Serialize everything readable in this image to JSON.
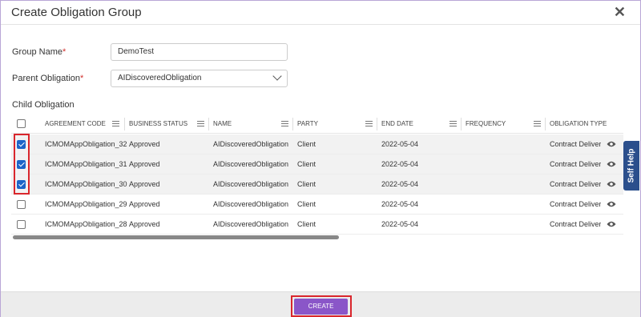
{
  "dialog": {
    "title": "Create Obligation Group",
    "close_icon": "close-icon"
  },
  "form": {
    "group_name_label": "Group Name",
    "group_name_value": "DemoTest",
    "parent_obligation_label": "Parent Obligation",
    "parent_obligation_value": "AIDiscoveredObligation",
    "required_marker": "*"
  },
  "grid": {
    "section_label": "Child Obligation",
    "columns": [
      "AGREEMENT CODE",
      "BUSINESS STATUS",
      "NAME",
      "PARTY",
      "END DATE",
      "FREQUENCY",
      "OBLIGATION TYPE"
    ],
    "rows": [
      {
        "checked": true,
        "agreement_code": "ICMOMAppObligation_32",
        "business_status": "Approved",
        "name": "AIDiscoveredObligation",
        "party": "Client",
        "end_date": "2022-05-04",
        "frequency": "",
        "obligation_type": "Contract Deliverat"
      },
      {
        "checked": true,
        "agreement_code": "ICMOMAppObligation_31",
        "business_status": "Approved",
        "name": "AIDiscoveredObligation",
        "party": "Client",
        "end_date": "2022-05-04",
        "frequency": "",
        "obligation_type": "Contract Deliverat"
      },
      {
        "checked": true,
        "agreement_code": "ICMOMAppObligation_30",
        "business_status": "Approved",
        "name": "AIDiscoveredObligation",
        "party": "Client",
        "end_date": "2022-05-04",
        "frequency": "",
        "obligation_type": "Contract Deliverat"
      },
      {
        "checked": false,
        "agreement_code": "ICMOMAppObligation_29",
        "business_status": "Approved",
        "name": "AIDiscoveredObligation",
        "party": "Client",
        "end_date": "2022-05-04",
        "frequency": "",
        "obligation_type": "Contract Deliverat"
      },
      {
        "checked": false,
        "agreement_code": "ICMOMAppObligation_28",
        "business_status": "Approved",
        "name": "AIDiscoveredObligation",
        "party": "Client",
        "end_date": "2022-05-04",
        "frequency": "",
        "obligation_type": "Contract Deliverat"
      }
    ]
  },
  "self_help": {
    "label": "Self Help"
  },
  "footer": {
    "create_label": "CREATE"
  },
  "colors": {
    "accent": "#8a56c8",
    "checkbox": "#1c65c9",
    "highlight": "#d9262c",
    "self_help": "#2b4f8c"
  }
}
